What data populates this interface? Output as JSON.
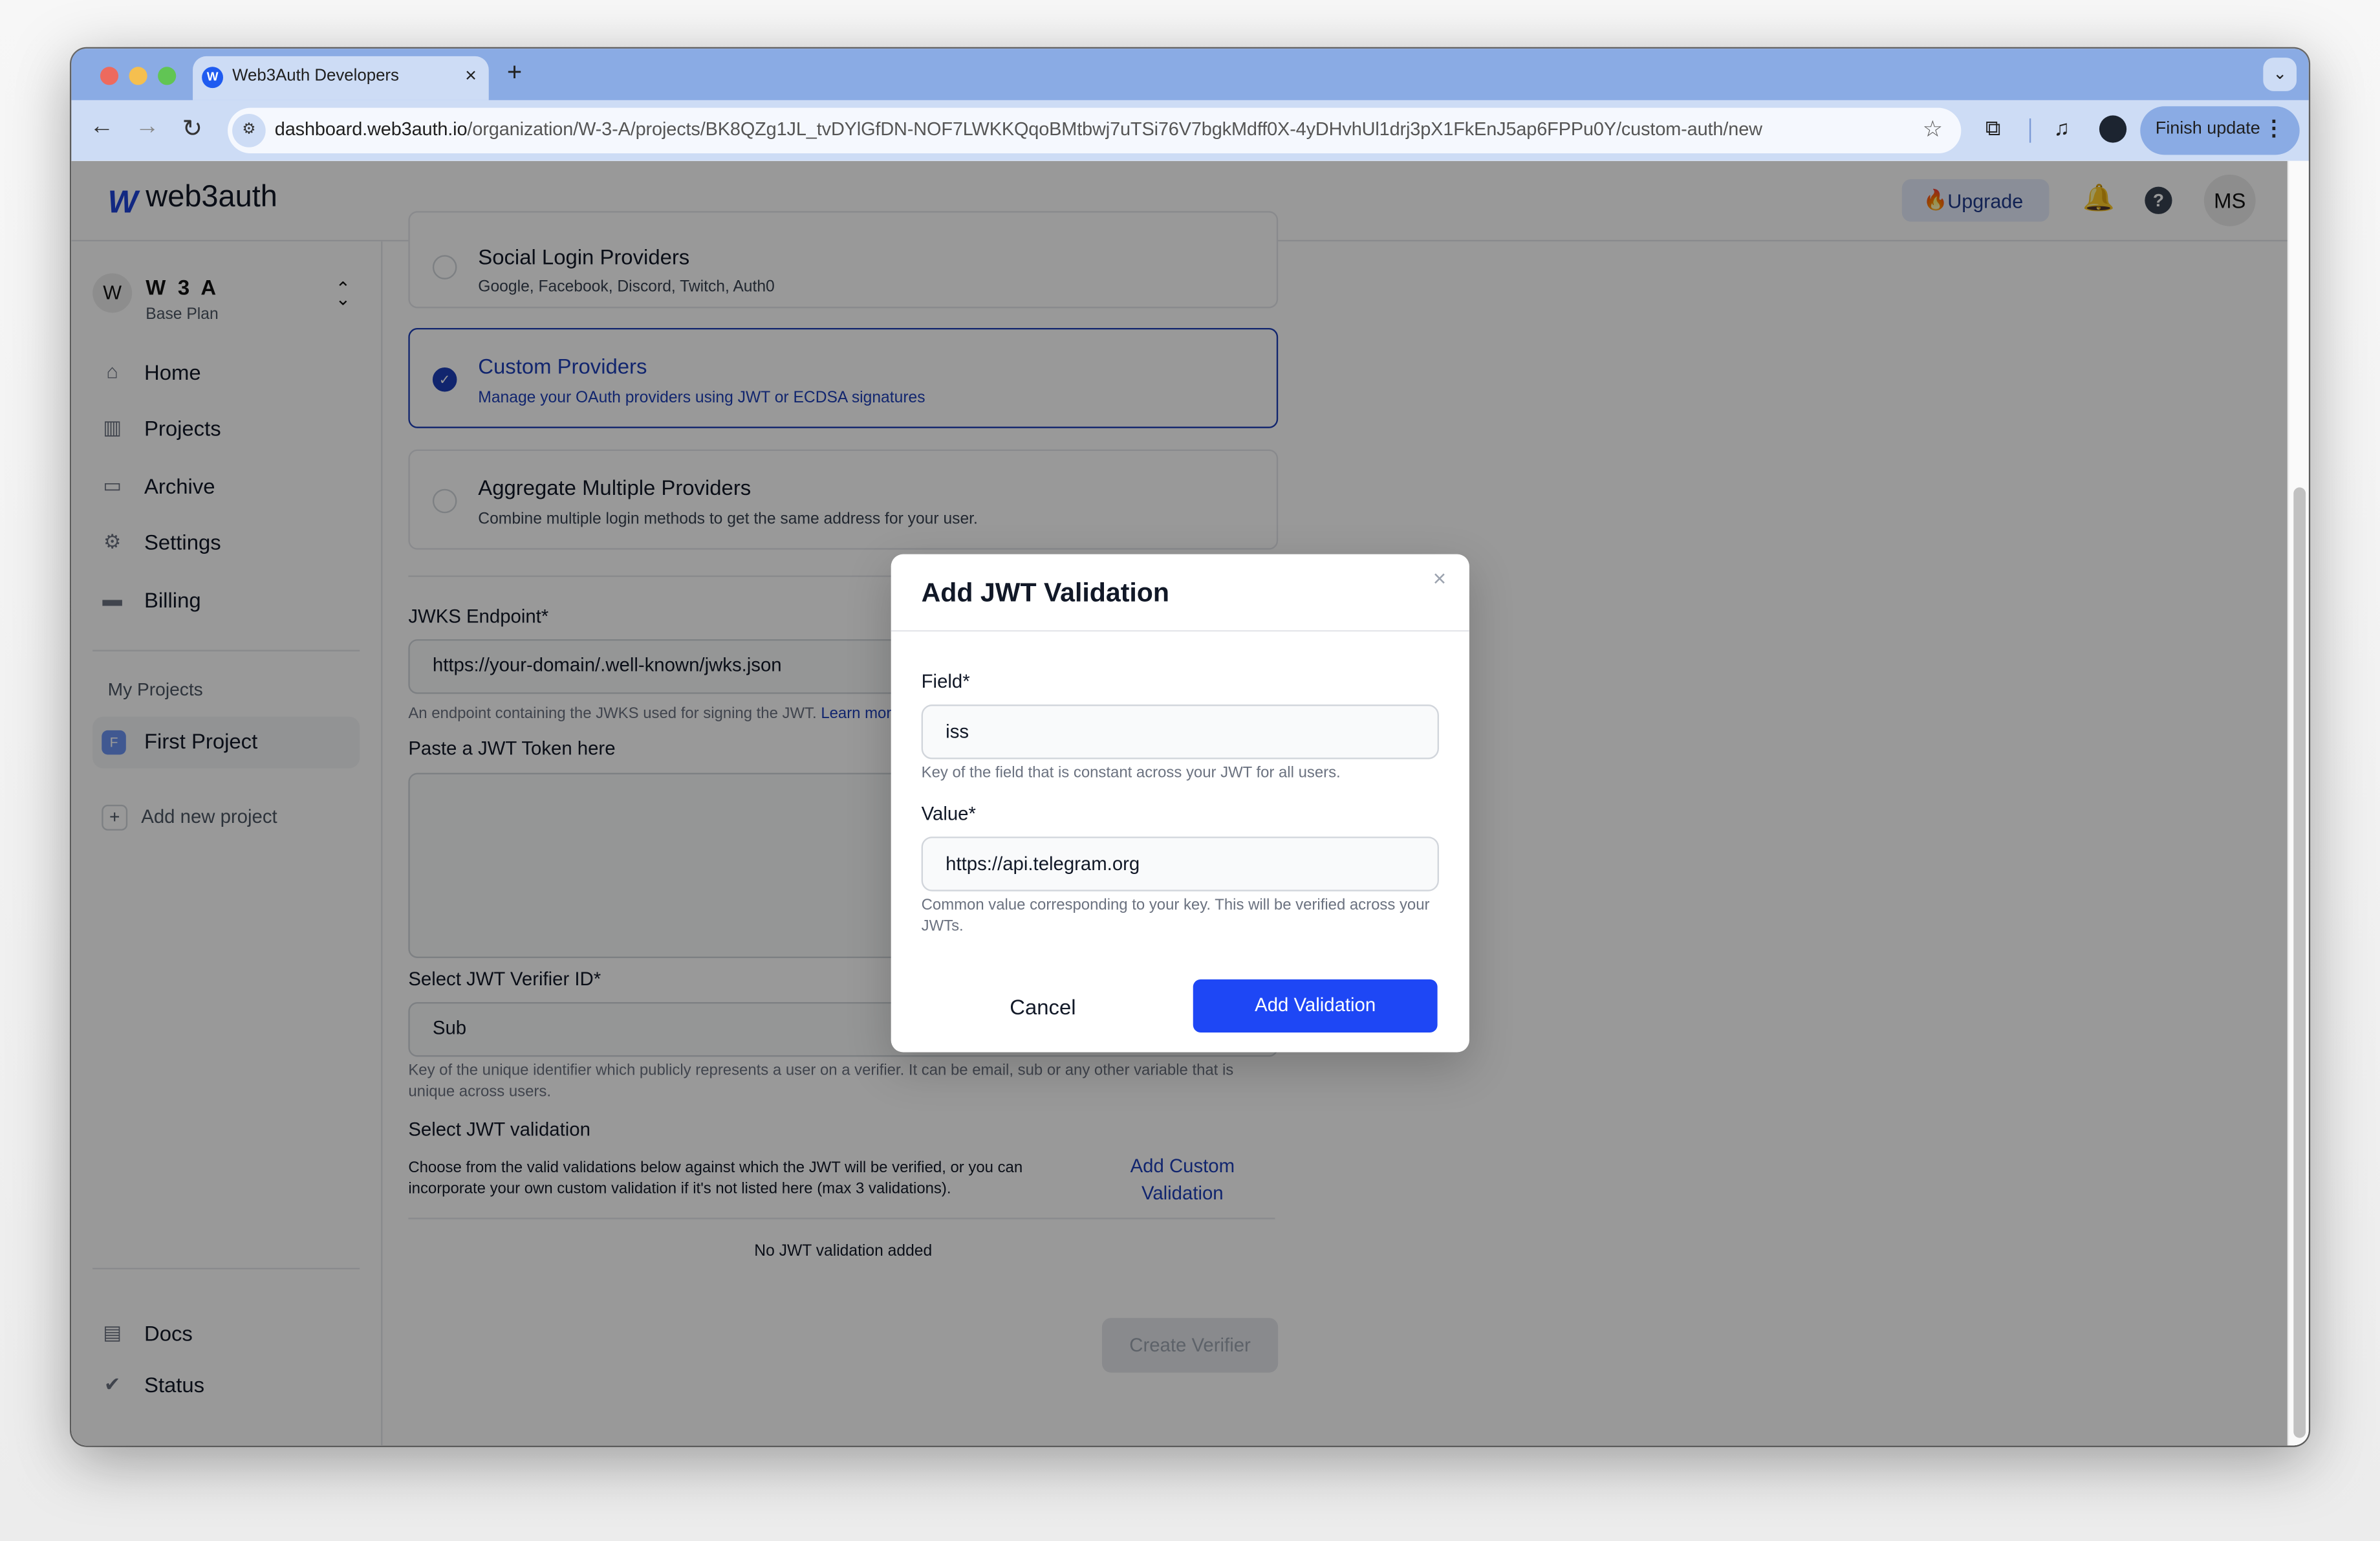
{
  "browser": {
    "tab_title": "Web3Auth Developers",
    "tab_favicon": "W",
    "url_host": "dashboard.web3auth.io",
    "url_path": "/organization/W-3-A/projects/BK8QZg1JL_tvDYlGfDN-NOF7LWKKQqoBMtbwj7uTSi76V7bgkMdff0X-4yDHvhUl1drj3pX1FkEnJ5ap6FPPu0Y/custom-auth/new",
    "finish_update_label": "Finish update",
    "icons": {
      "back": "←",
      "forward": "→",
      "reload": "↻",
      "site_info": "⚙",
      "star": "☆",
      "extensions": "⧉",
      "media": "♫",
      "new_tab": "+",
      "close": "×",
      "tab_menu": "⌄",
      "more": "⋮"
    },
    "traffic_light_colors": [
      "#ed6a5e",
      "#f5bf4f",
      "#61c554"
    ]
  },
  "header": {
    "logo_mark": "W",
    "logo_text": "web3auth",
    "upgrade_label": "Upgrade",
    "upgrade_icon": "🔥",
    "notification_icon": "🔔",
    "help_icon": "?",
    "user_initials": "MS"
  },
  "sidebar": {
    "org": {
      "initial": "W",
      "name": "W 3 A",
      "plan": "Base Plan",
      "switch_icon": "⌃⌄"
    },
    "nav": [
      {
        "label": "Home",
        "icon": "⌂"
      },
      {
        "label": "Projects",
        "icon": "▥"
      },
      {
        "label": "Archive",
        "icon": "▭"
      },
      {
        "label": "Settings",
        "icon": "⚙"
      },
      {
        "label": "Billing",
        "icon": "▬"
      }
    ],
    "my_projects_label": "My Projects",
    "projects": [
      {
        "initial": "F",
        "label": "First Project"
      }
    ],
    "add_project_label": "Add new project",
    "footer": [
      {
        "label": "Docs",
        "icon": "▤"
      },
      {
        "label": "Status",
        "icon": "✔"
      }
    ]
  },
  "main": {
    "login_options": [
      {
        "title": "Social Login Providers",
        "description": "Google, Facebook, Discord, Twitch, Auth0",
        "selected": false
      },
      {
        "title": "Custom Providers",
        "description": "Manage your OAuth providers using JWT or ECDSA signatures",
        "selected": true
      },
      {
        "title": "Aggregate Multiple Providers",
        "description": "Combine multiple login methods to get the same address for your user.",
        "selected": false
      }
    ],
    "jwks": {
      "label": "JWKS Endpoint*",
      "placeholder": "https://your-domain/.well-known/jwks.json",
      "help": "An endpoint containing the JWKS used for signing the JWT. ",
      "help_link": "Learn more"
    },
    "jwt_token_label": "Paste a JWT Token here",
    "verifier_id": {
      "label": "Select JWT Verifier ID*",
      "value": "Sub",
      "help": "Key of the unique identifier which publicly represents a user on a verifier. It can be email, sub or any other variable that is unique across users."
    },
    "validation": {
      "label": "Select JWT validation",
      "description": "Choose from the valid validations below against which the JWT will be verified, or you can incorporate your own custom validation if it's not listed here (max 3 validations).",
      "add_custom_label": "Add Custom Validation",
      "empty_text": "No JWT validation added"
    },
    "create_verifier_label": "Create Verifier"
  },
  "modal": {
    "title": "Add JWT Validation",
    "close_icon": "×",
    "field_label": "Field*",
    "field_value": "iss",
    "field_help": "Key of the field that is constant across your JWT for all users.",
    "value_label": "Value*",
    "value_value": "https://api.telegram.org",
    "value_help": "Common value corresponding to your key. This will be verified across your JWTs.",
    "cancel_label": "Cancel",
    "submit_label": "Add Validation"
  },
  "colors": {
    "accent": "#1e47f5",
    "selected_border": "#1d3fb8",
    "tab_strip": "#8aabe4",
    "toolbar": "#cddcf5"
  }
}
